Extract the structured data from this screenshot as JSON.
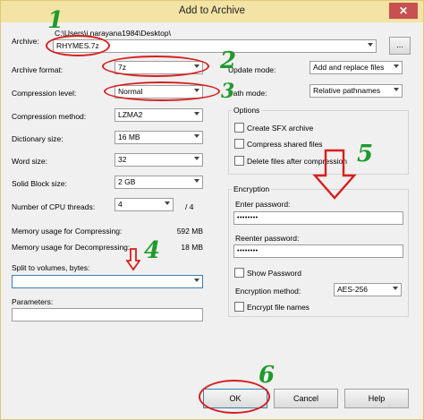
{
  "window": {
    "title": "Add to Archive",
    "close_glyph": "✕"
  },
  "archive": {
    "label": "Archive:",
    "path": "C:\\Users\\j.narayana1984\\Desktop\\",
    "name": "RHYMES.7z",
    "browse_label": "..."
  },
  "left": {
    "format_label": "Archive format:",
    "format_value": "7z",
    "level_label": "Compression level:",
    "level_value": "Normal",
    "method_label": "Compression method:",
    "method_value": "LZMA2",
    "dict_label": "Dictionary size:",
    "dict_value": "16 MB",
    "word_label": "Word size:",
    "word_value": "32",
    "block_label": "Solid Block size:",
    "block_value": "2 GB",
    "threads_label": "Number of CPU threads:",
    "threads_value": "4",
    "threads_max": "/ 4",
    "mem_comp_label": "Memory usage for Compressing:",
    "mem_comp_value": "592 MB",
    "mem_decomp_label": "Memory usage for Decompressing:",
    "mem_decomp_value": "18 MB",
    "split_label": "Split to volumes, bytes:",
    "split_value": "",
    "params_label": "Parameters:",
    "params_value": ""
  },
  "right": {
    "update_label": "Update mode:",
    "update_value": "Add and replace files",
    "path_label": "Path mode:",
    "path_value": "Relative pathnames",
    "options_title": "Options",
    "opt_sfx": "Create SFX archive",
    "opt_shared": "Compress shared files",
    "opt_delete": "Delete files after compression",
    "enc_title": "Encryption",
    "enter_pw_label": "Enter password:",
    "enter_pw_value": "••••••••",
    "reenter_pw_label": "Reenter password:",
    "reenter_pw_value": "••••••••",
    "show_pw": "Show Password",
    "enc_method_label": "Encryption method:",
    "enc_method_value": "AES-256",
    "encrypt_names": "Encrypt file names"
  },
  "buttons": {
    "ok": "OK",
    "cancel": "Cancel",
    "help": "Help"
  },
  "annotations": {
    "n1": "1",
    "n2": "2",
    "n3": "3",
    "n4": "4",
    "n5": "5",
    "n6": "6"
  },
  "colors": {
    "annotation_red": "#d81e1e",
    "annotation_green": "#1f9a2c"
  }
}
